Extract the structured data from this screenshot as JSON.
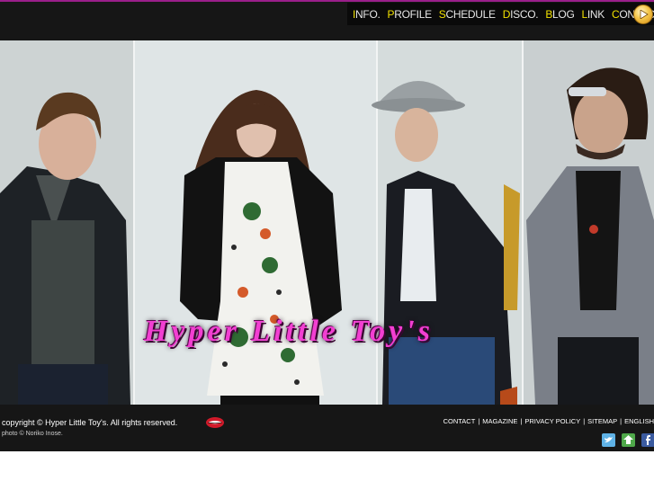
{
  "nav": {
    "items": [
      {
        "first": "I",
        "rest": "NFO."
      },
      {
        "first": "P",
        "rest": "ROFILE"
      },
      {
        "first": "S",
        "rest": "CHEDULE"
      },
      {
        "first": "D",
        "rest": "ISCO."
      },
      {
        "first": "B",
        "rest": "LOG"
      },
      {
        "first": "L",
        "rest": "INK"
      },
      {
        "first": "C",
        "rest": "ONTACT"
      }
    ]
  },
  "hero": {
    "band_title": "Hyper Little Toy's"
  },
  "footer": {
    "copyright": "copyright © Hyper Little Toy's. All rights reserved.",
    "photo_credit": "photo © Noriko Inose.",
    "links": [
      "CONTACT",
      "MAGAZINE",
      "PRIVACY POLICY",
      "SITEMAP",
      "ENGLISH"
    ],
    "link_separator": "|"
  },
  "colors": {
    "accent_magenta": "#f23fd2",
    "nav_initial": "#f0e000",
    "top_border": "#9a1f8a"
  },
  "icons": {
    "play": "play-icon",
    "social": [
      "twitter-icon",
      "share-icon",
      "facebook-icon"
    ]
  }
}
